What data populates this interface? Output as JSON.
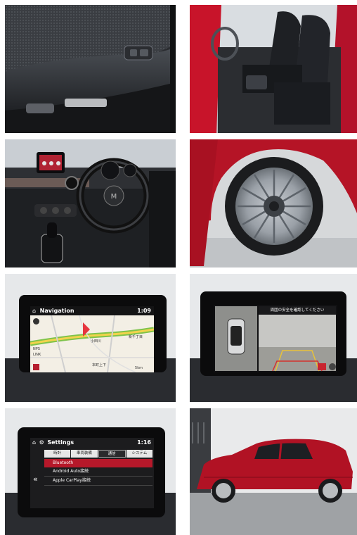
{
  "navigation_screen": {
    "title": "Navigation",
    "time": "1:09",
    "map_labels": [
      "NPS",
      "LINK",
      "小田川",
      "新千丁目",
      "本町上下"
    ],
    "scale": "5km"
  },
  "camera_screen": {
    "warning": "周囲の安全を確認してください"
  },
  "settings_screen": {
    "title": "Settings",
    "time": "1:16",
    "tabs": [
      "時計",
      "車両装備",
      "通信",
      "システム"
    ],
    "items": [
      "Bluetooth",
      "Android Auto接続",
      "Apple CarPlay接続"
    ]
  }
}
